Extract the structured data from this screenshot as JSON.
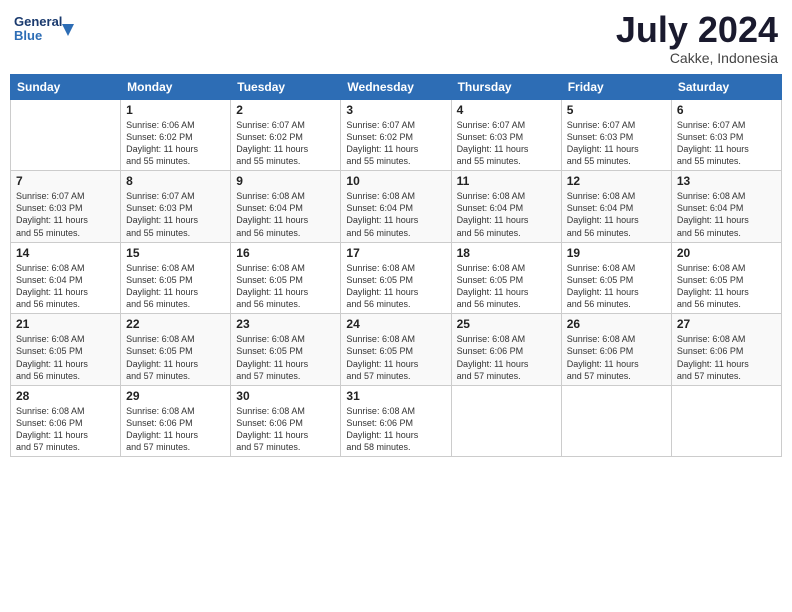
{
  "header": {
    "logo_line1": "General",
    "logo_line2": "Blue",
    "month": "July 2024",
    "location": "Cakke, Indonesia"
  },
  "weekdays": [
    "Sunday",
    "Monday",
    "Tuesday",
    "Wednesday",
    "Thursday",
    "Friday",
    "Saturday"
  ],
  "weeks": [
    [
      {
        "day": "",
        "info": ""
      },
      {
        "day": "1",
        "info": "Sunrise: 6:06 AM\nSunset: 6:02 PM\nDaylight: 11 hours\nand 55 minutes."
      },
      {
        "day": "2",
        "info": "Sunrise: 6:07 AM\nSunset: 6:02 PM\nDaylight: 11 hours\nand 55 minutes."
      },
      {
        "day": "3",
        "info": "Sunrise: 6:07 AM\nSunset: 6:02 PM\nDaylight: 11 hours\nand 55 minutes."
      },
      {
        "day": "4",
        "info": "Sunrise: 6:07 AM\nSunset: 6:03 PM\nDaylight: 11 hours\nand 55 minutes."
      },
      {
        "day": "5",
        "info": "Sunrise: 6:07 AM\nSunset: 6:03 PM\nDaylight: 11 hours\nand 55 minutes."
      },
      {
        "day": "6",
        "info": "Sunrise: 6:07 AM\nSunset: 6:03 PM\nDaylight: 11 hours\nand 55 minutes."
      }
    ],
    [
      {
        "day": "7",
        "info": "Sunrise: 6:07 AM\nSunset: 6:03 PM\nDaylight: 11 hours\nand 55 minutes."
      },
      {
        "day": "8",
        "info": "Sunrise: 6:07 AM\nSunset: 6:03 PM\nDaylight: 11 hours\nand 55 minutes."
      },
      {
        "day": "9",
        "info": "Sunrise: 6:08 AM\nSunset: 6:04 PM\nDaylight: 11 hours\nand 56 minutes."
      },
      {
        "day": "10",
        "info": "Sunrise: 6:08 AM\nSunset: 6:04 PM\nDaylight: 11 hours\nand 56 minutes."
      },
      {
        "day": "11",
        "info": "Sunrise: 6:08 AM\nSunset: 6:04 PM\nDaylight: 11 hours\nand 56 minutes."
      },
      {
        "day": "12",
        "info": "Sunrise: 6:08 AM\nSunset: 6:04 PM\nDaylight: 11 hours\nand 56 minutes."
      },
      {
        "day": "13",
        "info": "Sunrise: 6:08 AM\nSunset: 6:04 PM\nDaylight: 11 hours\nand 56 minutes."
      }
    ],
    [
      {
        "day": "14",
        "info": "Sunrise: 6:08 AM\nSunset: 6:04 PM\nDaylight: 11 hours\nand 56 minutes."
      },
      {
        "day": "15",
        "info": "Sunrise: 6:08 AM\nSunset: 6:05 PM\nDaylight: 11 hours\nand 56 minutes."
      },
      {
        "day": "16",
        "info": "Sunrise: 6:08 AM\nSunset: 6:05 PM\nDaylight: 11 hours\nand 56 minutes."
      },
      {
        "day": "17",
        "info": "Sunrise: 6:08 AM\nSunset: 6:05 PM\nDaylight: 11 hours\nand 56 minutes."
      },
      {
        "day": "18",
        "info": "Sunrise: 6:08 AM\nSunset: 6:05 PM\nDaylight: 11 hours\nand 56 minutes."
      },
      {
        "day": "19",
        "info": "Sunrise: 6:08 AM\nSunset: 6:05 PM\nDaylight: 11 hours\nand 56 minutes."
      },
      {
        "day": "20",
        "info": "Sunrise: 6:08 AM\nSunset: 6:05 PM\nDaylight: 11 hours\nand 56 minutes."
      }
    ],
    [
      {
        "day": "21",
        "info": "Sunrise: 6:08 AM\nSunset: 6:05 PM\nDaylight: 11 hours\nand 56 minutes."
      },
      {
        "day": "22",
        "info": "Sunrise: 6:08 AM\nSunset: 6:05 PM\nDaylight: 11 hours\nand 57 minutes."
      },
      {
        "day": "23",
        "info": "Sunrise: 6:08 AM\nSunset: 6:05 PM\nDaylight: 11 hours\nand 57 minutes."
      },
      {
        "day": "24",
        "info": "Sunrise: 6:08 AM\nSunset: 6:05 PM\nDaylight: 11 hours\nand 57 minutes."
      },
      {
        "day": "25",
        "info": "Sunrise: 6:08 AM\nSunset: 6:06 PM\nDaylight: 11 hours\nand 57 minutes."
      },
      {
        "day": "26",
        "info": "Sunrise: 6:08 AM\nSunset: 6:06 PM\nDaylight: 11 hours\nand 57 minutes."
      },
      {
        "day": "27",
        "info": "Sunrise: 6:08 AM\nSunset: 6:06 PM\nDaylight: 11 hours\nand 57 minutes."
      }
    ],
    [
      {
        "day": "28",
        "info": "Sunrise: 6:08 AM\nSunset: 6:06 PM\nDaylight: 11 hours\nand 57 minutes."
      },
      {
        "day": "29",
        "info": "Sunrise: 6:08 AM\nSunset: 6:06 PM\nDaylight: 11 hours\nand 57 minutes."
      },
      {
        "day": "30",
        "info": "Sunrise: 6:08 AM\nSunset: 6:06 PM\nDaylight: 11 hours\nand 57 minutes."
      },
      {
        "day": "31",
        "info": "Sunrise: 6:08 AM\nSunset: 6:06 PM\nDaylight: 11 hours\nand 58 minutes."
      },
      {
        "day": "",
        "info": ""
      },
      {
        "day": "",
        "info": ""
      },
      {
        "day": "",
        "info": ""
      }
    ]
  ]
}
